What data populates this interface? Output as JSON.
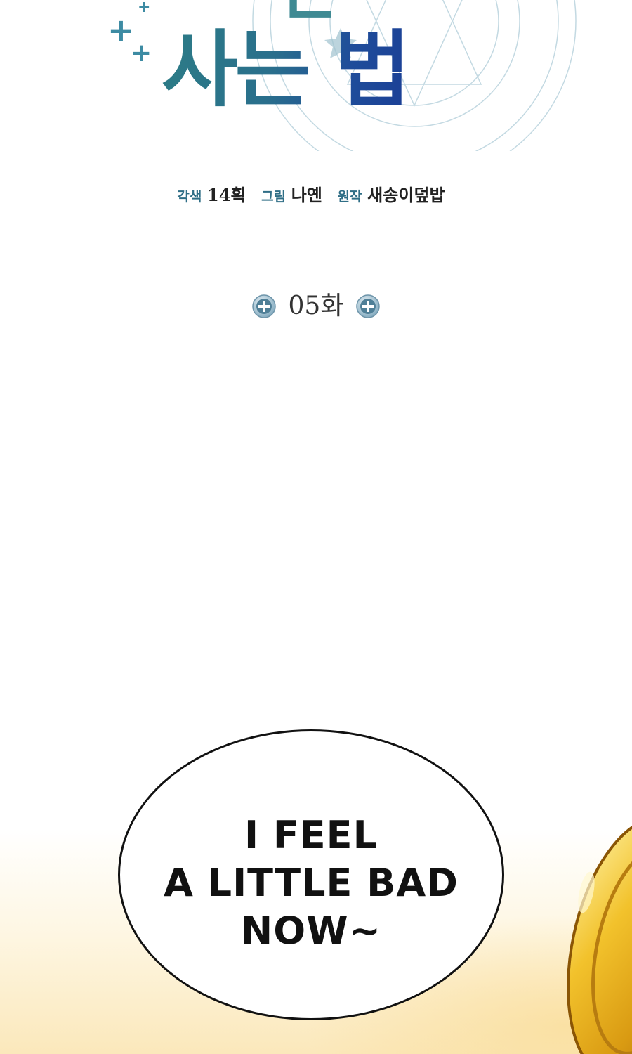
{
  "title": {
    "partial_top_text": "는",
    "main_text": "사는 법"
  },
  "credits": [
    {
      "role": "각색",
      "name": "14획"
    },
    {
      "role": "그림",
      "name": "나옌"
    },
    {
      "role": "원작",
      "name": "새송이덮밥"
    }
  ],
  "chapter": {
    "label": "05화",
    "icon": "plus-circle-icon"
  },
  "bubble": {
    "lines": [
      "I FEEL",
      "A LITTLE BAD",
      "NOW~"
    ]
  },
  "colors": {
    "title_teal": "#2c7c86",
    "title_blue": "#1b3f96",
    "credit_role": "#2f6e86",
    "coin_gold": "#e8b020"
  }
}
